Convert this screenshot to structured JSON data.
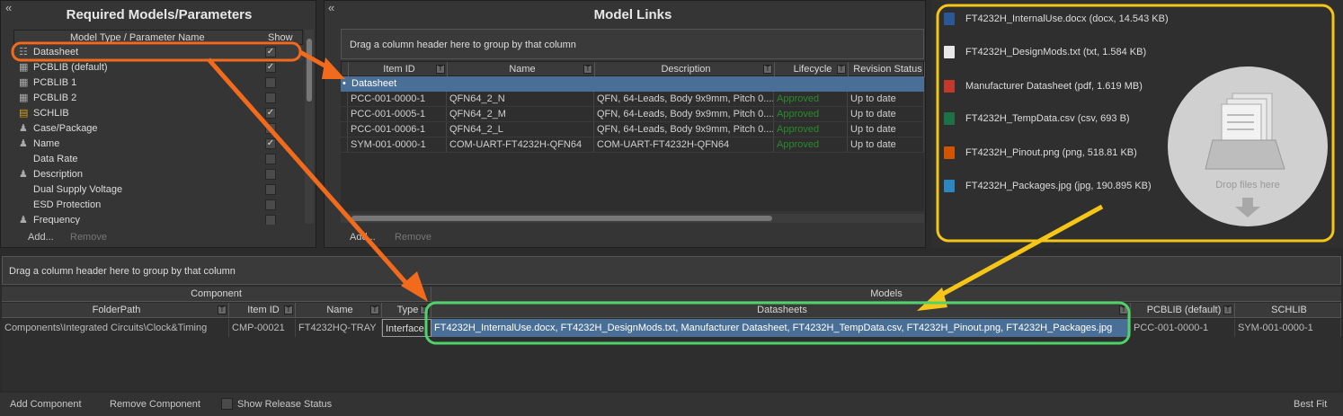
{
  "req_panel": {
    "title": "Required Models/Parameters",
    "col_name": "Model Type / Parameter Name",
    "col_show": "Show",
    "items": [
      {
        "label": "Datasheet",
        "show": true
      },
      {
        "label": "PCBLIB (default)",
        "show": true
      },
      {
        "label": "PCBLIB 1",
        "show": false
      },
      {
        "label": "PCBLIB 2",
        "show": false
      },
      {
        "label": "SCHLIB",
        "show": true
      },
      {
        "label": "Case/Package",
        "show": false
      },
      {
        "label": "Name",
        "show": true
      },
      {
        "label": "Data Rate",
        "show": false
      },
      {
        "label": "Description",
        "show": false
      },
      {
        "label": "Dual Supply Voltage",
        "show": false
      },
      {
        "label": "ESD Protection",
        "show": false
      },
      {
        "label": "Frequency",
        "show": false
      }
    ],
    "add": "Add...",
    "remove": "Remove"
  },
  "links_panel": {
    "title": "Model Links",
    "group_hint": "Drag a column header here to group by that column",
    "columns": [
      "Item ID",
      "Name",
      "Description",
      "Lifecycle",
      "Revision Status"
    ],
    "group_row": "Datasheet",
    "rows": [
      {
        "id": "PCC-001-0000-1",
        "name": "QFN64_2_N",
        "desc": "QFN, 64-Leads, Body 9x9mm, Pitch 0....",
        "life": "Approved",
        "rev": "Up to date"
      },
      {
        "id": "PCC-001-0005-1",
        "name": "QFN64_2_M",
        "desc": "QFN, 64-Leads, Body 9x9mm, Pitch 0....",
        "life": "Approved",
        "rev": "Up to date"
      },
      {
        "id": "PCC-001-0006-1",
        "name": "QFN64_2_L",
        "desc": "QFN, 64-Leads, Body 9x9mm, Pitch 0....",
        "life": "Approved",
        "rev": "Up to date"
      },
      {
        "id": "SYM-001-0000-1",
        "name": "COM-UART-FT4232H-QFN64",
        "desc": "COM-UART-FT4232H-QFN64",
        "life": "Approved",
        "rev": "Up to date"
      }
    ],
    "add": "Add...",
    "remove": "Remove"
  },
  "files": [
    {
      "label": "FT4232H_InternalUse.docx (docx, 14.543  KB)",
      "icon": "word-doc-icon",
      "color": "#2b5797"
    },
    {
      "label": "FT4232H_DesignMods.txt (txt, 1.584  KB)",
      "icon": "text-file-icon",
      "color": "#e8e8e8"
    },
    {
      "label": "Manufacturer Datasheet (pdf, 1.619  MB)",
      "icon": "pdf-file-icon",
      "color": "#c0392b"
    },
    {
      "label": "FT4232H_TempData.csv (csv, 693  B)",
      "icon": "excel-csv-icon",
      "color": "#1e7145"
    },
    {
      "label": "FT4232H_Pinout.png (png, 518.81  KB)",
      "icon": "png-image-icon",
      "color": "#d35400"
    },
    {
      "label": "FT4232H_Packages.jpg (jpg, 190.895  KB)",
      "icon": "jpg-image-icon",
      "color": "#2e86c1"
    }
  ],
  "drop_label": "Drop files here",
  "bottom": {
    "group_hint": "Drag a column header here to group by that column",
    "band_component": "Component",
    "band_models": "Models",
    "columns": [
      "FolderPath",
      "Item ID",
      "Name",
      "Type",
      "Datasheets",
      "PCBLIB (default)",
      "SCHLIB"
    ],
    "row": {
      "folder": "Components\\Integrated Circuits\\Clock&Timing",
      "id": "CMP-00021",
      "name": "FT4232HQ-TRAY",
      "type": "Interface",
      "datasheets": "FT4232H_InternalUse.docx, FT4232H_DesignMods.txt, Manufacturer Datasheet, FT4232H_TempData.csv, FT4232H_Pinout.png, FT4232H_Packages.jpg",
      "pcblib": "PCC-001-0000-1",
      "schlib": "SYM-001-0000-1"
    },
    "add_component": "Add Component",
    "remove_component": "Remove Component",
    "show_release": "Show Release Status",
    "best_fit": "Best Fit"
  },
  "collapse_glyph": "«",
  "colors": {
    "orange": "#f26b1d",
    "yellow": "#f5c518",
    "green": "#4fd26a",
    "selection": "#4a6f96"
  }
}
